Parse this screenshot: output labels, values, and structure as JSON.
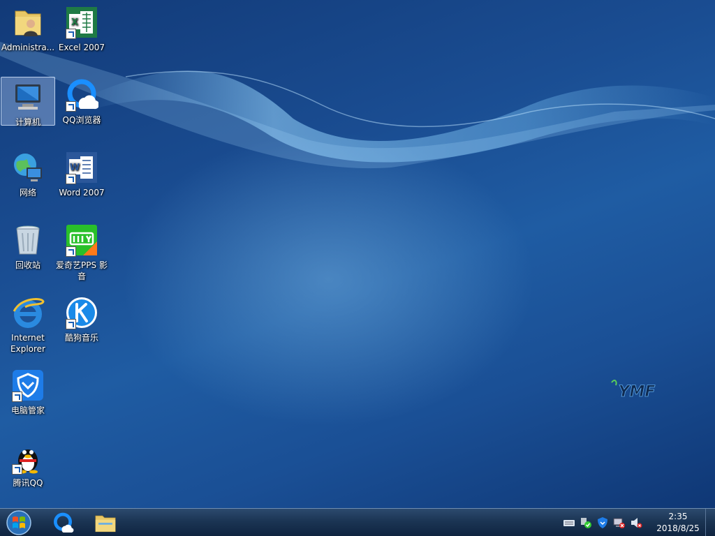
{
  "desktop_icons": [
    {
      "id": "administrator",
      "label": "Administra..."
    },
    {
      "id": "excel",
      "label": "Excel 2007"
    },
    {
      "id": "computer",
      "label": "计算机"
    },
    {
      "id": "qq-browser",
      "label": "QQ浏览器"
    },
    {
      "id": "network",
      "label": "网络"
    },
    {
      "id": "word",
      "label": "Word 2007"
    },
    {
      "id": "recycle-bin",
      "label": "回收站"
    },
    {
      "id": "iqiyi",
      "label_line1": "爱奇艺PPS 影",
      "label_line2": "音"
    },
    {
      "id": "ie",
      "label_line1": "Internet",
      "label_line2": "Explorer"
    },
    {
      "id": "kugou",
      "label": "酷狗音乐"
    },
    {
      "id": "pc-manager",
      "label": "电脑管家"
    },
    {
      "id": "tencent-qq",
      "label": "腾讯QQ"
    }
  ],
  "watermark_text": "YMF",
  "taskbar": {
    "apps": [
      "qq-browser",
      "file-explorer"
    ],
    "tray_icons": [
      "keyboard-icon",
      "security-check-icon",
      "shield-icon",
      "network-x-icon",
      "volume-muted-icon"
    ],
    "clock_time": "2:35",
    "clock_date": "2018/8/25"
  },
  "colors": {
    "accent": "#1a4d92",
    "taskbar": "#1b3554"
  }
}
